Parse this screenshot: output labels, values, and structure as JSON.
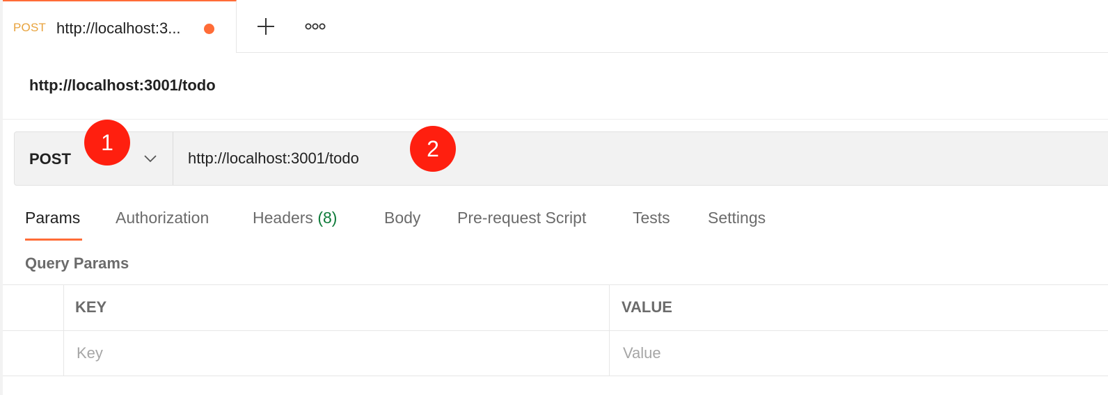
{
  "tab": {
    "method": "POST",
    "title": "http://localhost:3...",
    "unsaved_color": "#ff6c37"
  },
  "tab_actions": {
    "new_tab_icon": "plus-icon",
    "more_icon": "ellipsis-icon"
  },
  "request": {
    "name": "http://localhost:3001/todo",
    "method": "POST",
    "url": "http://localhost:3001/todo"
  },
  "annotations": [
    "1",
    "2"
  ],
  "request_tabs": [
    {
      "label": "Params",
      "active": true
    },
    {
      "label": "Authorization"
    },
    {
      "label": "Headers",
      "count": "(8)"
    },
    {
      "label": "Body"
    },
    {
      "label": "Pre-request Script"
    },
    {
      "label": "Tests"
    },
    {
      "label": "Settings"
    }
  ],
  "query_params": {
    "title": "Query Params",
    "columns": [
      "KEY",
      "VALUE"
    ],
    "placeholders": {
      "key": "Key",
      "value": "Value"
    }
  },
  "colors": {
    "accent": "#ff6c37",
    "badge": "#ff1f0f",
    "tab_method": "#e8a33d",
    "count": "#0f7b3a"
  }
}
